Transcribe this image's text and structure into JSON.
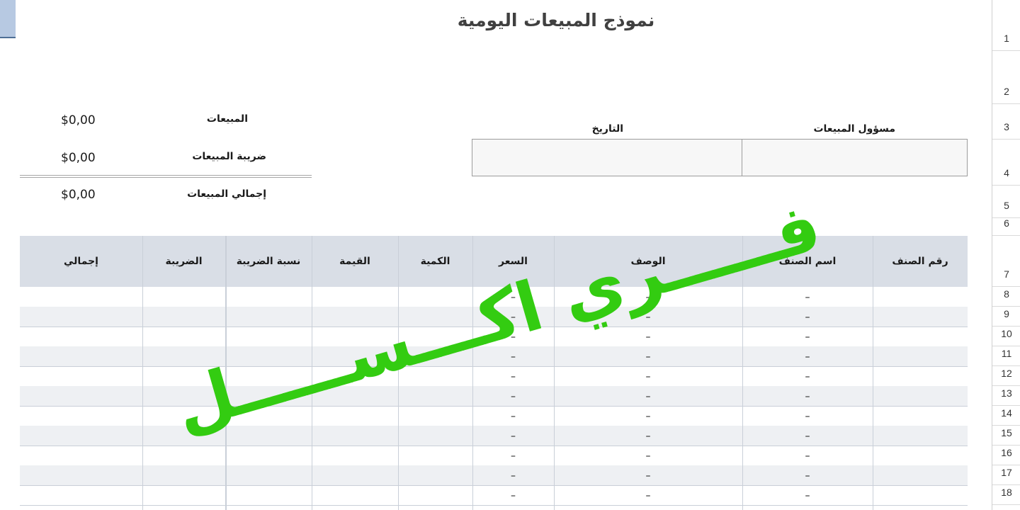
{
  "title": "نموذج المبيعات اليومية",
  "summary": [
    {
      "label": "المبيعات",
      "value": "$0,00"
    },
    {
      "label": "ضريبة المبيعات",
      "value": "$0,00"
    },
    {
      "label": "إجمالي المبيعات",
      "value": "$0,00"
    }
  ],
  "header_fields": {
    "salesperson_label": "مسؤول المبيعات",
    "date_label": "التاريخ",
    "salesperson_value": "",
    "date_value": ""
  },
  "table": {
    "columns": [
      "رقم الصنف",
      "اسم الصنف",
      "الوصف",
      "السعر",
      "الكمية",
      "القيمة",
      "نسبة الضريبة",
      "الضريبة",
      "إجمالي"
    ],
    "rows": [
      {
        "name": "–",
        "desc": "–",
        "price": "–"
      },
      {
        "name": "–",
        "desc": "–",
        "price": "–"
      },
      {
        "name": "–",
        "desc": "–",
        "price": "–"
      },
      {
        "name": "–",
        "desc": "–",
        "price": "–"
      },
      {
        "name": "–",
        "desc": "–",
        "price": "–"
      },
      {
        "name": "–",
        "desc": "–",
        "price": "–"
      },
      {
        "name": "–",
        "desc": "–",
        "price": "–"
      },
      {
        "name": "–",
        "desc": "–",
        "price": "–"
      },
      {
        "name": "–",
        "desc": "–",
        "price": "–"
      },
      {
        "name": "–",
        "desc": "–",
        "price": "–"
      },
      {
        "name": "–",
        "desc": "–",
        "price": "–"
      }
    ]
  },
  "row_numbers": [
    "1",
    "2",
    "3",
    "4",
    "5",
    "6",
    "7",
    "8",
    "9",
    "10",
    "11",
    "12",
    "13",
    "14",
    "15",
    "16",
    "17",
    "18"
  ],
  "watermark": "فـــــري اكـــســـــل",
  "colors": {
    "header_fill": "#d9dee6",
    "row_alt": "#eef0f3",
    "watermark": "#33cc11",
    "accent": "#b7c9e2"
  }
}
